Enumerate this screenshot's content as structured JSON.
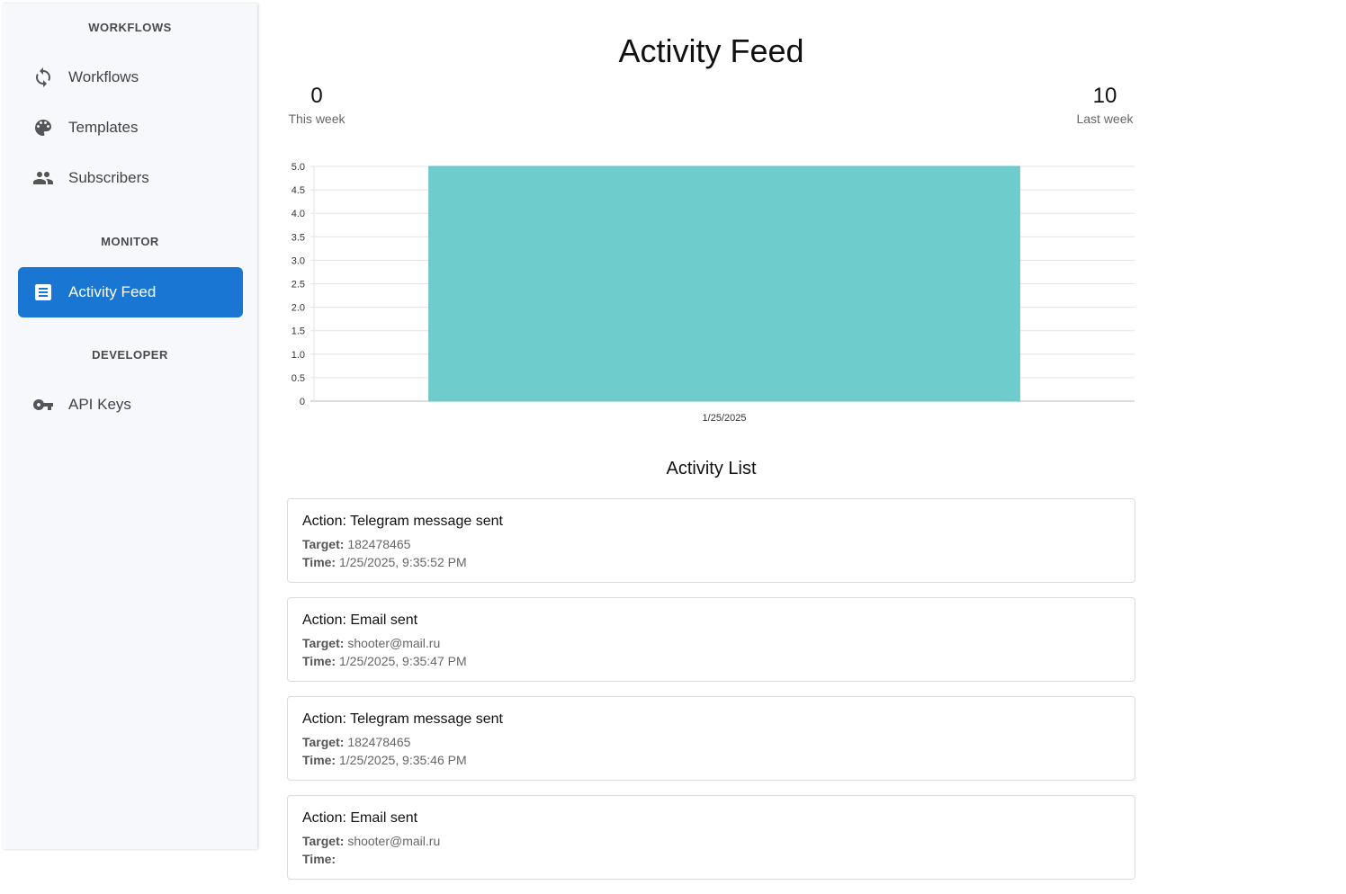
{
  "sidebar": {
    "sections": [
      {
        "title": "WORKFLOWS"
      },
      {
        "title": "MONITOR"
      },
      {
        "title": "DEVELOPER"
      }
    ],
    "items": [
      {
        "label": "Workflows",
        "icon": "sync-icon",
        "active": false
      },
      {
        "label": "Templates",
        "icon": "palette-icon",
        "active": false
      },
      {
        "label": "Subscribers",
        "icon": "people-icon",
        "active": false
      },
      {
        "label": "Activity Feed",
        "icon": "list-icon",
        "active": true
      },
      {
        "label": "API Keys",
        "icon": "key-icon",
        "active": false
      }
    ]
  },
  "colors": {
    "accent": "#1976d2",
    "bar": "#6ecccc",
    "sidebar_bg": "#f7f8fc"
  },
  "main": {
    "title": "Activity Feed",
    "stats": {
      "this_week": {
        "value": "0",
        "caption": "This week"
      },
      "last_week": {
        "value": "10",
        "caption": "Last week"
      }
    },
    "list_title": "Activity List",
    "activities": [
      {
        "action": "Action: Telegram message sent",
        "target_label": "Target:",
        "target": "182478465",
        "time_label": "Time:",
        "time": "1/25/2025, 9:35:52 PM"
      },
      {
        "action": "Action: Email sent",
        "target_label": "Target:",
        "target": "shooter@mail.ru",
        "time_label": "Time:",
        "time": "1/25/2025, 9:35:47 PM"
      },
      {
        "action": "Action: Telegram message sent",
        "target_label": "Target:",
        "target": "182478465",
        "time_label": "Time:",
        "time": "1/25/2025, 9:35:46 PM"
      },
      {
        "action": "Action: Email sent",
        "target_label": "Target:",
        "target": "shooter@mail.ru",
        "time_label": "Time:",
        "time": ""
      }
    ]
  },
  "chart_data": {
    "type": "bar",
    "categories": [
      "1/25/2025"
    ],
    "values": [
      5
    ],
    "ylim": [
      0,
      5
    ],
    "yticks": [
      "0",
      "0.5",
      "1.0",
      "1.5",
      "2.0",
      "2.5",
      "3.0",
      "3.5",
      "4.0",
      "4.5",
      "5.0"
    ],
    "grid": true,
    "legend": "none"
  }
}
